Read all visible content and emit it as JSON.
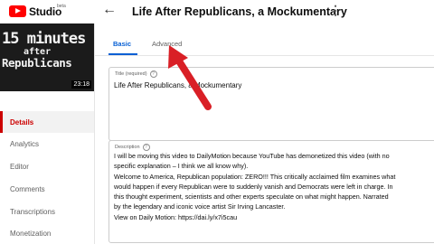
{
  "header": {
    "app_name": "Studio",
    "beta_label": "beta",
    "video_title": "Life After Republicans, a Mockumentary"
  },
  "thumbnail": {
    "line1": "15 minutes",
    "line2": "after",
    "line3": "Republicans",
    "duration": "23:18"
  },
  "sidebar": {
    "items": [
      {
        "label": "Details",
        "active": true
      },
      {
        "label": "Analytics"
      },
      {
        "label": "Editor"
      },
      {
        "label": "Comments"
      },
      {
        "label": "Transcriptions"
      },
      {
        "label": "Monetization"
      }
    ]
  },
  "tabs": [
    {
      "label": "Basic",
      "active": true
    },
    {
      "label": "Advanced"
    }
  ],
  "title_field": {
    "label": "Title (required)",
    "value": "Life After Republicans, a Mockumentary"
  },
  "description_field": {
    "label": "Description",
    "lines": [
      "I will be moving this video to DailyMotion because YouTube has demonetized this video (with no",
      "specific explanation – I think we all know why).",
      "Welcome to America, Republican population: ZERO!!! This critically acclaimed film examines what",
      "would happen if every Republican were to suddenly vanish and Democrats were left in charge. In",
      "this thought experiment, scientists and other experts speculate on what might happen. Narrated",
      "by the legendary and iconic voice artist Sir Irving Lancaster.",
      "View on Daily Motion: https://dai.ly/x7i5cau"
    ]
  },
  "colors": {
    "accent": "#065fd4",
    "brand": "#ff0000",
    "arrow": "#d91f26"
  }
}
